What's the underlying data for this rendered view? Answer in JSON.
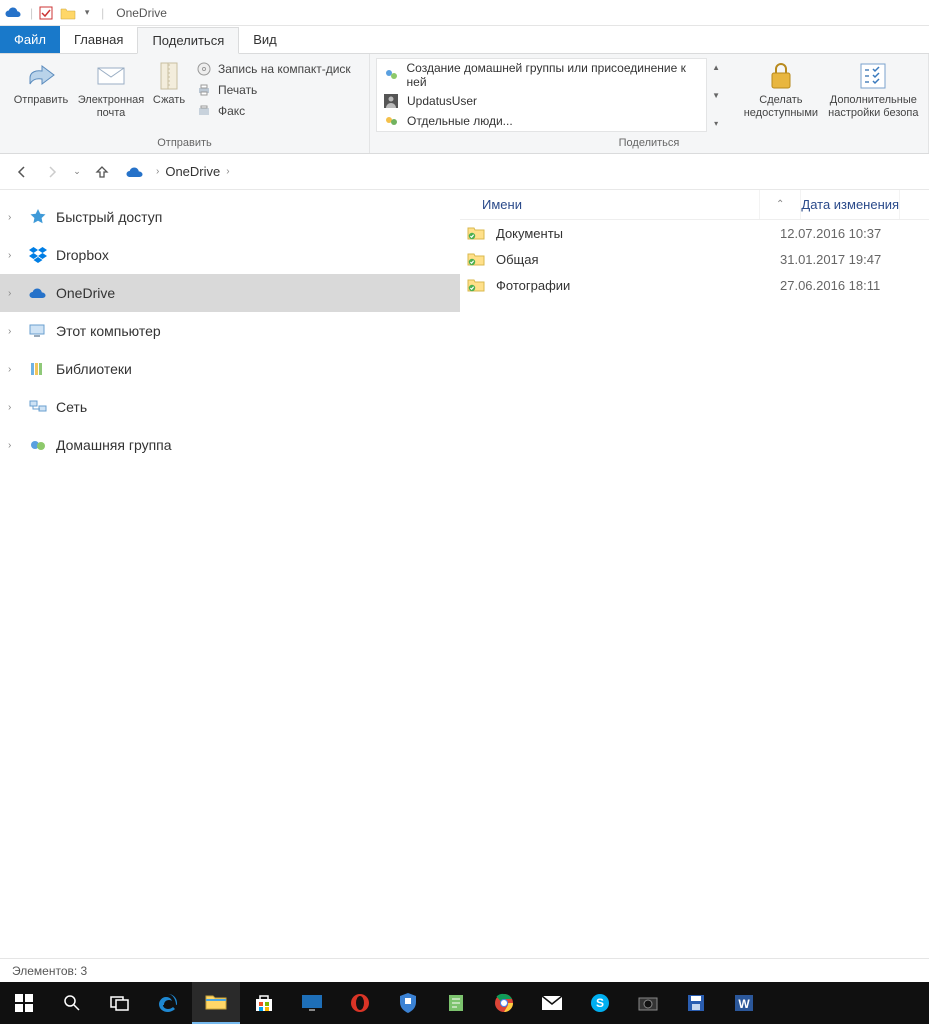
{
  "window": {
    "title": "OneDrive"
  },
  "tabs": {
    "file": "Файл",
    "home": "Главная",
    "share": "Поделиться",
    "view": "Вид"
  },
  "ribbon": {
    "send_group_label": "Отправить",
    "send_btn": "Отправить",
    "email_btn": "Электронная почта",
    "compress_btn": "Сжать",
    "burn": "Запись на компакт-диск",
    "print": "Печать",
    "fax": "Факс",
    "share_group_label": "Поделиться",
    "homegroup": "Создание домашней группы или присоединение к ней",
    "updatus": "UpdatusUser",
    "people": "Отдельные люди...",
    "make_unavailable": "Сделать недоступными",
    "advanced_security": "Дополнительные настройки безопа"
  },
  "breadcrumb": {
    "root": "OneDrive"
  },
  "columns": {
    "name": "Имени",
    "date": "Дата изменения"
  },
  "nav": {
    "quick": "Быстрый доступ",
    "dropbox": "Dropbox",
    "onedrive": "OneDrive",
    "thispc": "Этот компьютер",
    "libraries": "Библиотеки",
    "network": "Сеть",
    "homegroup": "Домашняя группа"
  },
  "files": [
    {
      "name": "Документы",
      "date": "12.07.2016 10:37"
    },
    {
      "name": "Общая",
      "date": "31.01.2017 19:47"
    },
    {
      "name": "Фотографии",
      "date": "27.06.2016 18:11"
    }
  ],
  "status": {
    "elements": "Элементов: 3"
  }
}
